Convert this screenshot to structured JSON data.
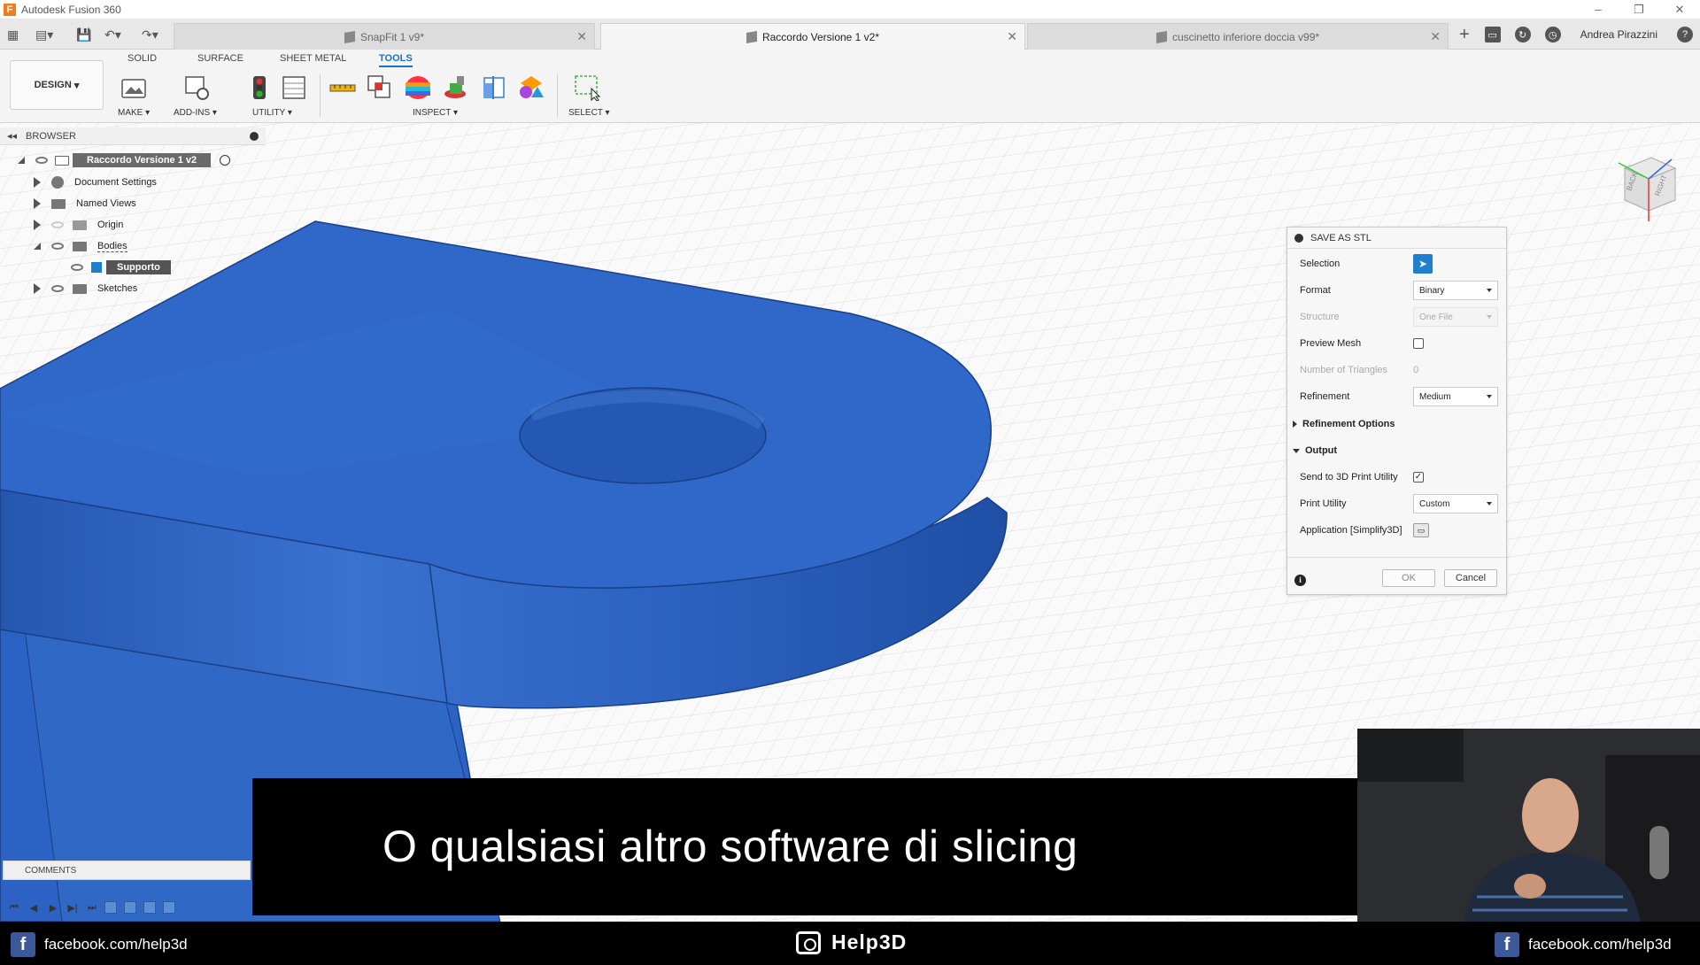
{
  "app": {
    "title": "Autodesk Fusion 360",
    "logo_letter": "F"
  },
  "window_controls": {
    "minimize": "–",
    "restore": "❐",
    "close": "✕"
  },
  "tabs": [
    {
      "label": "SnapFit 1 v9*",
      "active": false
    },
    {
      "label": "Raccordo Versione 1 v2*",
      "active": true
    },
    {
      "label": "cuscinetto inferiore doccia v99*",
      "active": false
    }
  ],
  "user": {
    "name": "Andrea Pirazzini"
  },
  "toolbar": {
    "workspace": "DESIGN",
    "workspace_tabs": [
      "SOLID",
      "SURFACE",
      "SHEET METAL",
      "TOOLS"
    ],
    "active_tab": "TOOLS",
    "groups": [
      "MAKE",
      "ADD-INS",
      "UTILITY",
      "INSPECT",
      "SELECT"
    ]
  },
  "browser": {
    "title": "BROWSER",
    "root": "Raccordo Versione 1 v2",
    "items": [
      "Document Settings",
      "Named Views",
      "Origin",
      "Bodies",
      "Supporto",
      "Sketches"
    ]
  },
  "dialog": {
    "title": "SAVE AS STL",
    "selection_label": "Selection",
    "format_label": "Format",
    "format_value": "Binary",
    "structure_label": "Structure",
    "structure_value": "One File",
    "preview_mesh_label": "Preview Mesh",
    "triangles_label": "Number of Triangles",
    "triangles_value": "0",
    "refinement_label": "Refinement",
    "refinement_value": "Medium",
    "refinement_options_label": "Refinement Options",
    "output_label": "Output",
    "send_label": "Send to 3D Print Utility",
    "send_checked": "✓",
    "print_utility_label": "Print Utility",
    "print_utility_value": "Custom",
    "application_label": "Application [Simplify3D]",
    "ok_label": "OK",
    "cancel_label": "Cancel"
  },
  "navcube": {
    "faces": [
      "BACK",
      "RIGHT"
    ]
  },
  "comments": {
    "label": "COMMENTS"
  },
  "subtitle": {
    "text": "O qualsiasi altro software di slicing"
  },
  "banner": {
    "left": "facebook.com/help3d",
    "center": "Help3D",
    "right": "facebook.com/help3d"
  },
  "colors": {
    "accent": "#1e7fd1",
    "part_blue": "#2f68c8",
    "background": "#fafafa"
  }
}
